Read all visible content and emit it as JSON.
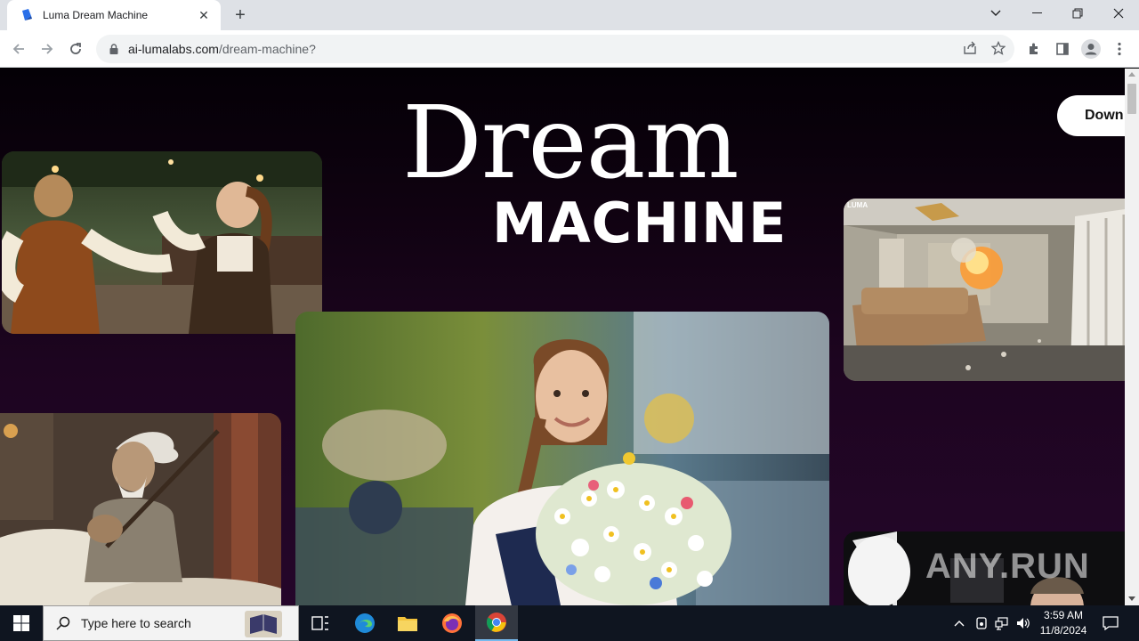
{
  "browser": {
    "tab_title": "Luma Dream Machine",
    "url_host": "ai-lumalabs.com",
    "url_path": "/dream-machine?"
  },
  "page": {
    "title_line1": "Dream",
    "title_line2": "MACHINE",
    "download_label": "Down",
    "room_card_logo": "LUMA",
    "watermark": "ANY.RUN"
  },
  "taskbar": {
    "search_placeholder": "Type here to search",
    "time": "3:59 AM",
    "date": "11/8/2024"
  },
  "colors": {
    "page_bg_top": "#040006",
    "page_bg_bottom": "#25062a",
    "taskbar_bg": "#0f1520"
  }
}
